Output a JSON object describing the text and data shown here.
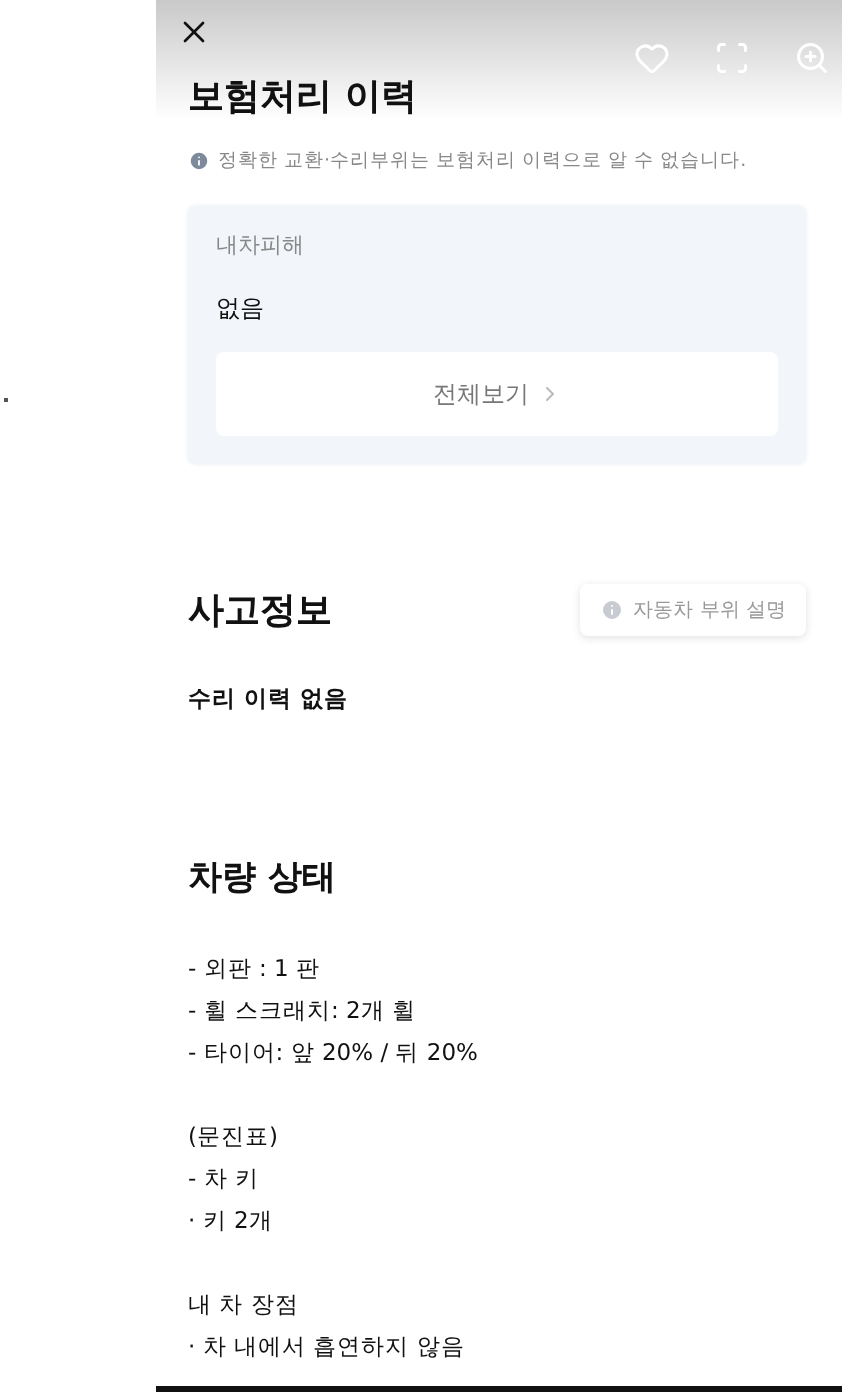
{
  "insurance": {
    "title": "보험처리 이력",
    "notice": "정확한 교환·수리부위는 보험처리 이력으로 알 수 없습니다.",
    "card": {
      "label": "내차피해",
      "value": "없음",
      "button": "전체보기"
    }
  },
  "accident": {
    "title": "사고정보",
    "button": "자동차 부위 설명",
    "summary": "수리 이력 없음"
  },
  "condition": {
    "title": "차량 상태",
    "groups": [
      [
        "- 외판 : 1 판",
        "- 휠 스크래치: 2개 휠",
        "- 타이어: 앞 20% / 뒤 20%"
      ],
      [
        "(문진표)",
        "- 차 키",
        "· 키 2개"
      ],
      [
        "내 차 장점",
        "· 차 내에서 흡연하지 않음"
      ]
    ]
  }
}
